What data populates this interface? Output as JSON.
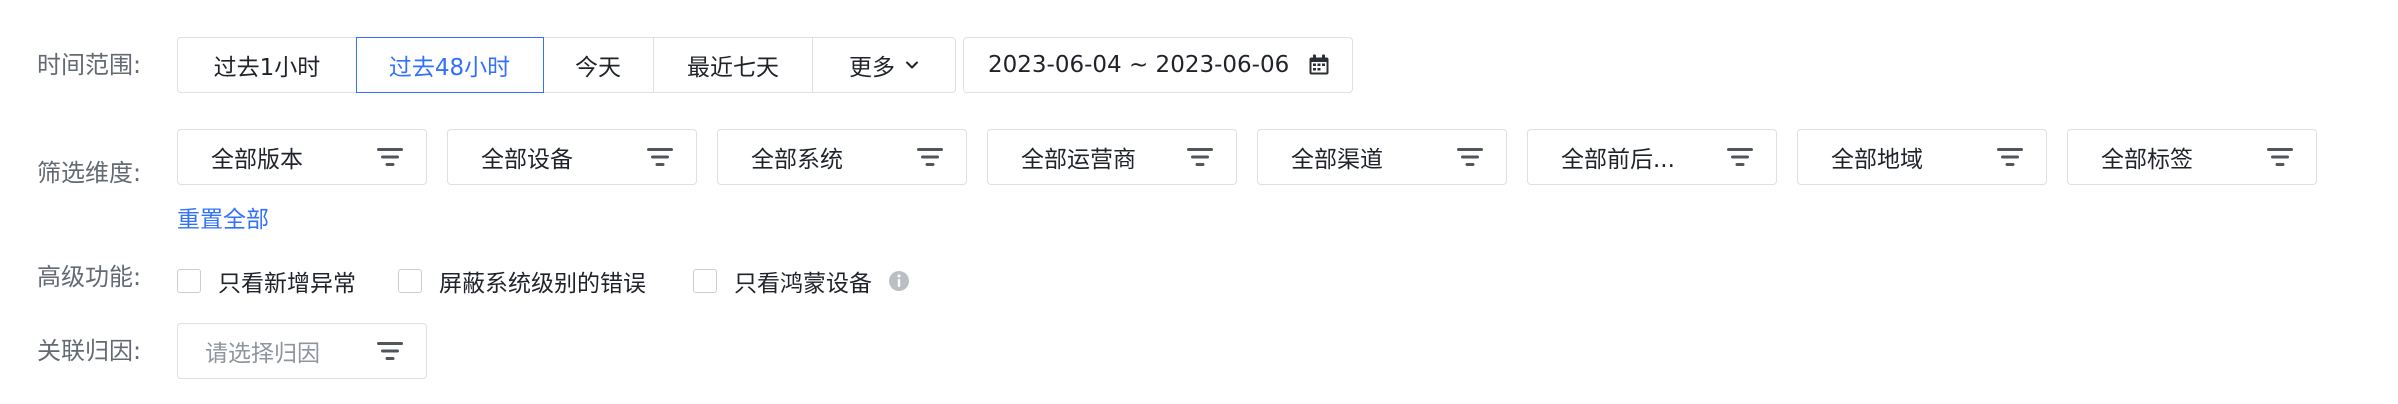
{
  "time_range": {
    "label": "时间范围:",
    "options": [
      {
        "label": "过去1小时",
        "active": false
      },
      {
        "label": "过去48小时",
        "active": true
      },
      {
        "label": "今天",
        "active": false
      },
      {
        "label": "最近七天",
        "active": false
      },
      {
        "label": "更多",
        "active": false
      }
    ],
    "date_range": "2023-06-04 ~ 2023-06-06",
    "date_icon": "calendar-icon"
  },
  "filters": {
    "label": "筛选维度:",
    "items": [
      "全部版本",
      "全部设备",
      "全部系统",
      "全部运营商",
      "全部渠道",
      "全部前后...",
      "全部地域",
      "全部标签"
    ],
    "filter_icon": "filter-icon",
    "reset_label": "重置全部"
  },
  "advanced": {
    "label": "高级功能:",
    "options": [
      {
        "label": "只看新增异常",
        "checked": false
      },
      {
        "label": "屏蔽系统级别的错误",
        "checked": false
      },
      {
        "label": "只看鸿蒙设备",
        "checked": false,
        "info_icon": "info-icon"
      }
    ]
  },
  "attribution": {
    "label": "关联归因:",
    "placeholder": "请选择归因"
  },
  "colors": {
    "accent": "#3370ff",
    "border": "#dee0e3",
    "label": "#646a73",
    "text": "#1f2329",
    "placeholder": "#8f959e"
  }
}
